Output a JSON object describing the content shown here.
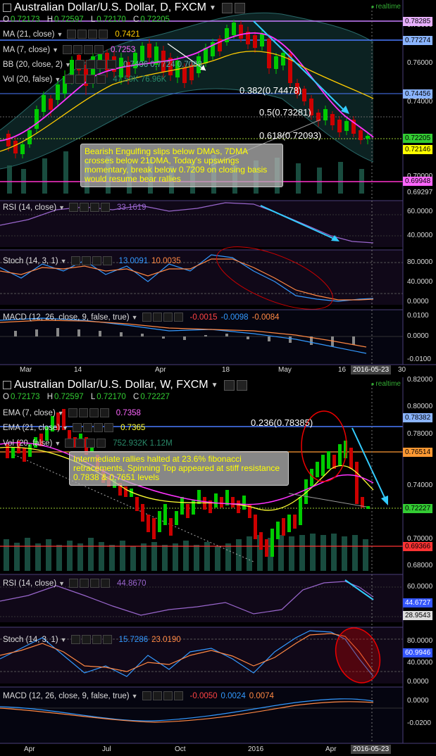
{
  "daily": {
    "title": "Australian Dollar/U.S. Dollar, D, FXCM",
    "realtime": "realtime",
    "ohlc": {
      "o_label": "O",
      "o": "0.72173",
      "h_label": "H",
      "h": "0.72597",
      "l_label": "L",
      "l": "0.72170",
      "c_label": "C",
      "c": "0.72205"
    },
    "legend_ma21": {
      "label": "MA (21, close)",
      "value": "0.7421"
    },
    "legend_ma7": {
      "label": "MA (7, close)",
      "value": "0.7253"
    },
    "legend_bb": {
      "label": "BB (20, close, 2)",
      "value": "0.7406 0.7724 0.7088"
    },
    "legend_vol": {
      "label": "Vol (20, false)",
      "value": "47.59K 76.96K"
    },
    "fibo": {
      "f382": "0.382(0.74478)",
      "f5": "0.5(0.73281)",
      "f618": "0.618(0.72093)"
    },
    "annotation": "Bearish Engulfing slips below DMAs, 7DMA crosses below 21DMA, Today's upswings momentary, break below 0.7209 on closing basis would resume bear rallies",
    "price_labels": [
      "0.78000",
      "0.76000",
      "0.74000",
      "0.70000",
      "0.69297"
    ],
    "price_tags": [
      {
        "text": "0.78285",
        "color": "#e8b0ff"
      },
      {
        "text": "0.77274",
        "color": "#8ab4ff"
      },
      {
        "text": "0.74456",
        "color": "#8ab4ff"
      },
      {
        "text": "0.72205",
        "color": "#33cc33"
      },
      {
        "text": "0.72146",
        "color": "#ffff00"
      },
      {
        "text": "0.69948",
        "color": "#ff66ff"
      }
    ],
    "rsi": {
      "label": "RSI (14, close)",
      "value": "33.1619",
      "axis": [
        "60.0000",
        "40.0000"
      ]
    },
    "stoch": {
      "label": "Stoch (14, 3, 1)",
      "k": "13.0091",
      "d": "10.0035",
      "axis": [
        "80.0000",
        "40.0000",
        "0.0000"
      ]
    },
    "macd": {
      "label": "MACD (12, 26, close, 9, false, true)",
      "v1": "-0.0015",
      "v2": "-0.0098",
      "v3": "-0.0084",
      "axis": [
        "0.0100",
        "0.0000",
        "-0.0100"
      ]
    },
    "dates": [
      "Mar",
      "14",
      "Apr",
      "18",
      "May",
      "16",
      "30"
    ],
    "date_tag": "2016-05-23"
  },
  "weekly": {
    "title": "Australian Dollar/U.S. Dollar, W, FXCM",
    "realtime": "realtime",
    "ohlc": {
      "o_label": "O",
      "o": "0.72173",
      "h_label": "H",
      "h": "0.72597",
      "l_label": "L",
      "l": "0.72170",
      "c_label": "C",
      "c": "0.72227"
    },
    "legend_ema7": {
      "label": "EMA (7, close)",
      "value": "0.7358"
    },
    "legend_ema21": {
      "label": "EMA (21, close)",
      "value": "0.7365"
    },
    "legend_vol": {
      "label": "Vol (20, false)",
      "value": "752.932K 1.12M"
    },
    "fibo": "0.236(0.78385)",
    "annotation": "Intermediate rallies halted at 23.6% fibonacci retracements, Spinning Top appeared at stiff resistance 0.7838 & 0.7651 levels",
    "price_labels": [
      "0.82000",
      "0.80000",
      "0.78000",
      "0.74000",
      "0.70000",
      "0.68000"
    ],
    "price_tags": [
      {
        "text": "0.78382",
        "color": "#8ab4ff"
      },
      {
        "text": "0.76514",
        "color": "#ff9933"
      },
      {
        "text": "0.72227",
        "color": "#33cc33"
      },
      {
        "text": "0.69366",
        "color": "#ff3333"
      }
    ],
    "rsi": {
      "label": "RSI (14, close)",
      "value": "44.8670",
      "axis": [
        "60.0000",
        "28.9543"
      ],
      "tag": "44.6727"
    },
    "stoch": {
      "label": "Stoch (14, 3, 1)",
      "k": "15.7286",
      "d": "23.0190",
      "axis": [
        "80.0000",
        "40.0000",
        "0.0000"
      ],
      "tag": "60.9946"
    },
    "macd": {
      "label": "MACD (12, 26, close, 9, false, true)",
      "v1": "-0.0050",
      "v2": "0.0024",
      "v3": "0.0074",
      "axis": [
        "0.0000",
        "-0.0200"
      ]
    },
    "dates": [
      "Apr",
      "Jul",
      "Oct",
      "2016",
      "Apr"
    ],
    "date_tag": "2016-05-23"
  }
}
